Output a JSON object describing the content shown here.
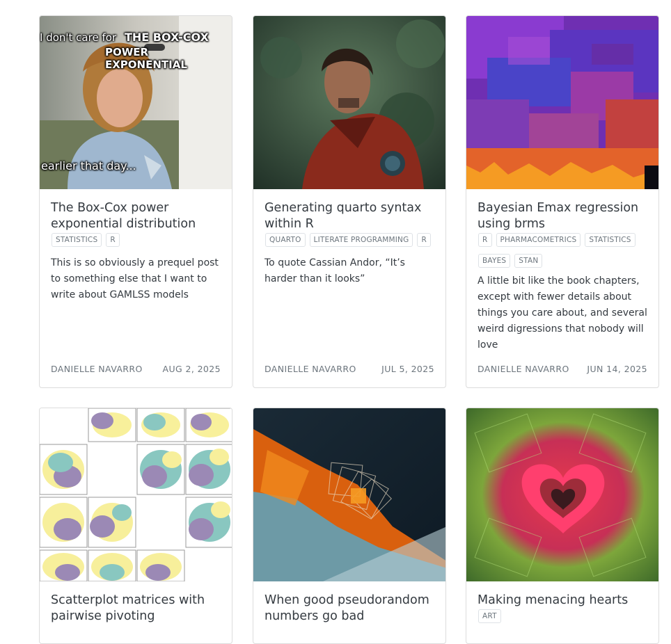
{
  "posts": [
    {
      "title": "The Box-Cox power exponential distribution",
      "tags": [
        "STATISTICS",
        "R"
      ],
      "description": "This is so obviously a prequel post to something else that I want to write about GAMLSS models",
      "author": "DANIELLE NAVARRO",
      "date": "AUG 2, 2025",
      "thumbnail": {
        "caption_prefix": "I don't care for",
        "caption_line1": "THE BOX-COX",
        "caption_line2": "POWER EXPONENTIAL",
        "caption_bottom": "earlier that day..."
      }
    },
    {
      "title": "Generating quarto syntax within R",
      "tags": [
        "QUARTO",
        "LITERATE PROGRAMMING",
        "R"
      ],
      "description": "To quote Cassian Andor, “It’s harder than it looks”",
      "author": "DANIELLE NAVARRO",
      "date": "JUL 5, 2025"
    },
    {
      "title": "Bayesian Emax regression using brms",
      "tags": [
        "R",
        "PHARMACOMETRICS",
        "STATISTICS",
        "BAYES",
        "STAN"
      ],
      "description": "A little bit like the book chapters, except with fewer details about things you care about, and several weird digressions that nobody will love",
      "author": "DANIELLE NAVARRO",
      "date": "JUN 14, 2025"
    },
    {
      "title": "Scatterplot matrices with pairwise pivoting",
      "tags": []
    },
    {
      "title": "When good pseudorandom numbers go bad",
      "tags": []
    },
    {
      "title": "Making menacing hearts",
      "tags": [
        "ART"
      ]
    }
  ],
  "colors": {
    "border": "#dcdcdc",
    "text": "#343a40",
    "muted": "#6c757d"
  }
}
